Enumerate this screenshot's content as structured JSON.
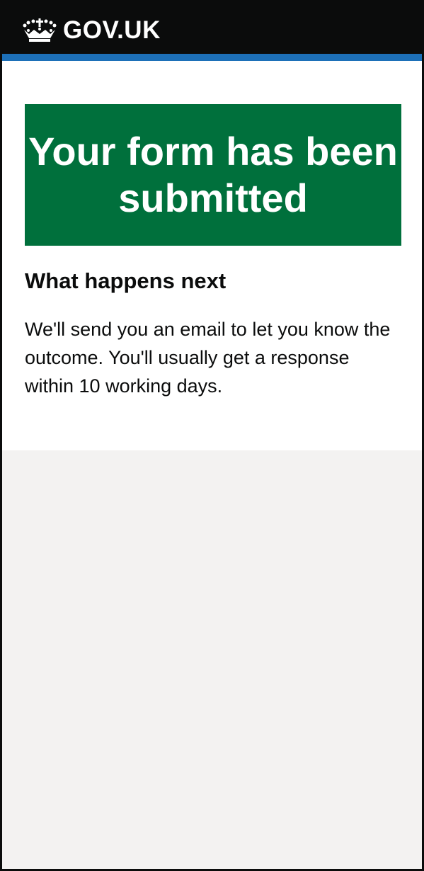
{
  "header": {
    "logo_text": "GOV.UK",
    "logo_icon": "crown-icon"
  },
  "colors": {
    "header": "#0b0c0c",
    "accent_bar": "#1d70b8",
    "panel": "#00703c",
    "background": "#f3f2f1"
  },
  "panel": {
    "title": "Your form has been submitted"
  },
  "next": {
    "heading": "What happens next",
    "body": "We'll send you an email to let you know the outcome. You'll usually get a response within 10 working days."
  }
}
